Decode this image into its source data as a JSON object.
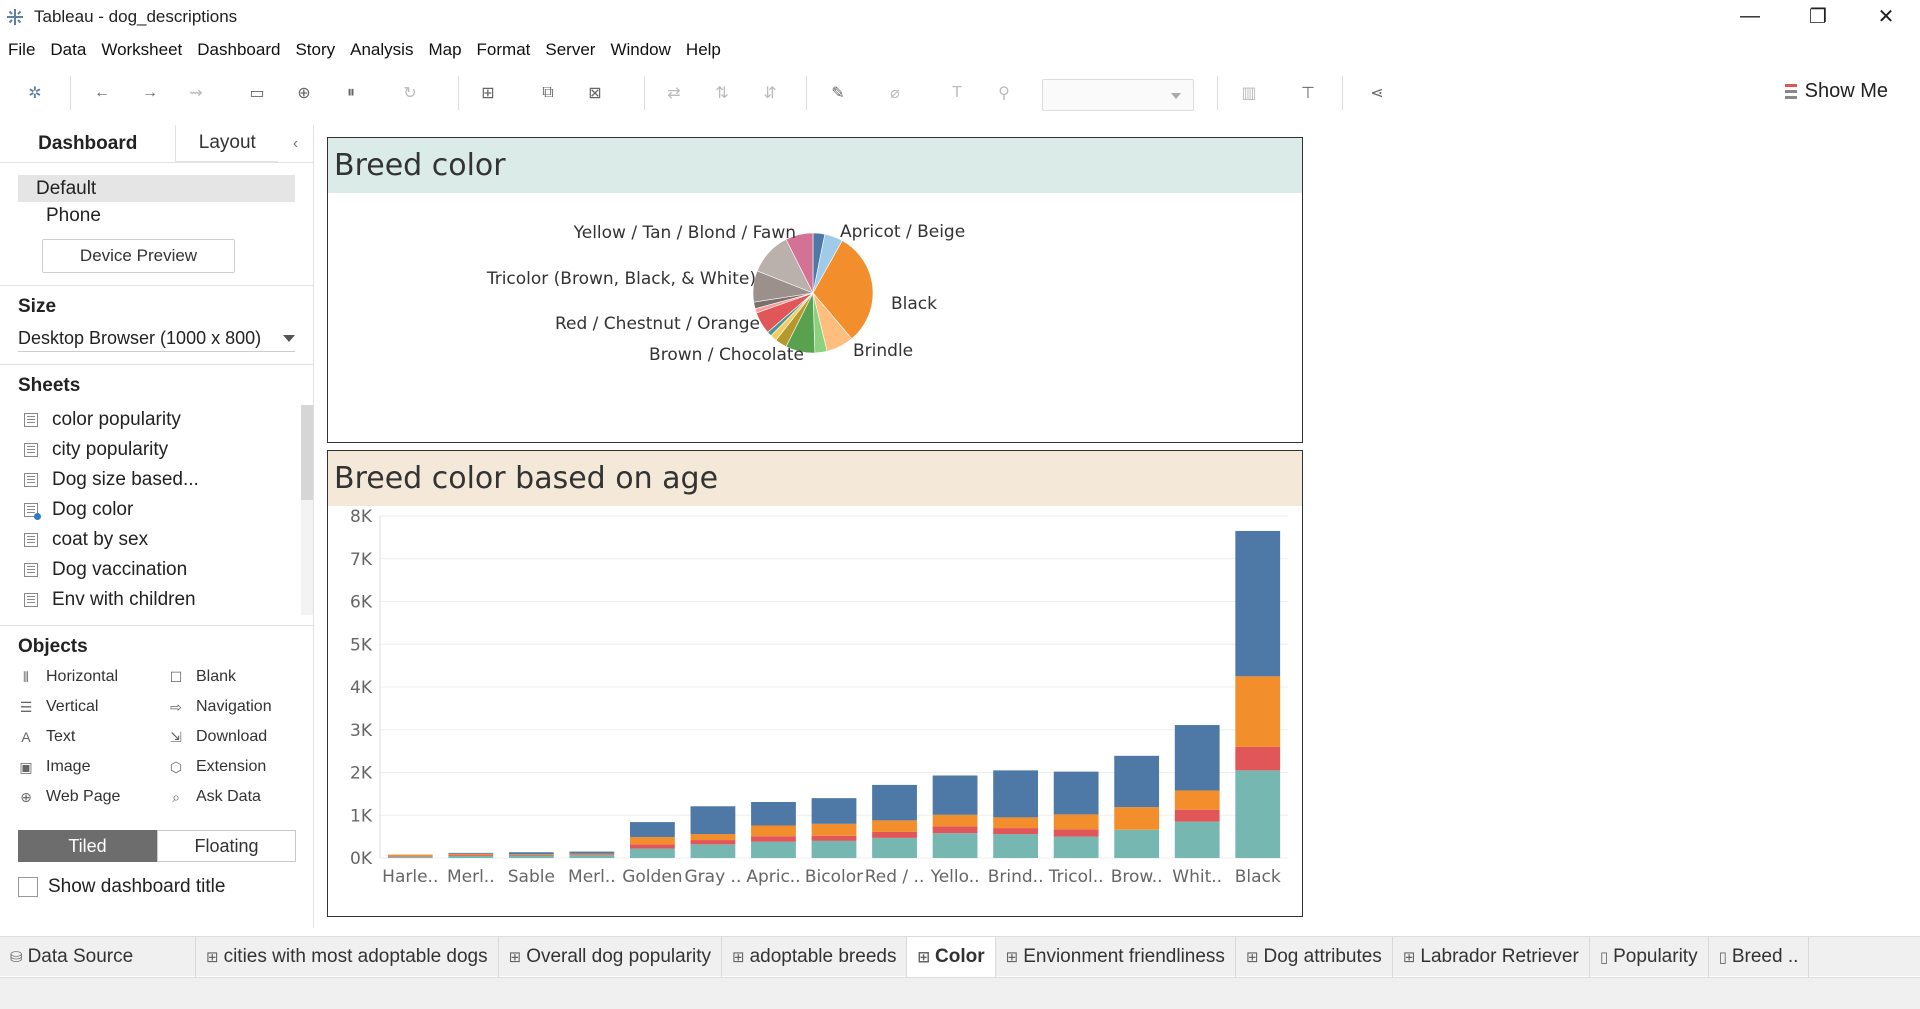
{
  "window": {
    "title": "Tableau - dog_descriptions",
    "minimize_glyph": "—",
    "restore_glyph": "❐",
    "close_glyph": "✕"
  },
  "menu": [
    "File",
    "Data",
    "Worksheet",
    "Dashboard",
    "Story",
    "Analysis",
    "Map",
    "Format",
    "Server",
    "Window",
    "Help"
  ],
  "toolbar": {
    "show_me_label": "Show Me",
    "icons": [
      "tableau-logo-icon",
      "undo-icon",
      "redo-icon",
      "replay-icon",
      "save-icon",
      "new-data-source-icon",
      "pause-updates-icon",
      "refresh-icon",
      "new-worksheet-icon",
      "duplicate-icon",
      "clear-icon",
      "swap-icon",
      "sort-ascending-icon",
      "sort-descending-icon",
      "highlight-icon",
      "group-icon",
      "labels-icon",
      "fix-axes-icon",
      "fit-dropdown",
      "show-cards-icon",
      "presentation-icon",
      "share-icon"
    ]
  },
  "left_panel": {
    "tabs": {
      "dashboard": "Dashboard",
      "layout": "Layout",
      "collapse": "‹"
    },
    "devices": {
      "default": "Default",
      "phone": "Phone",
      "preview_button": "Device Preview"
    },
    "size": {
      "title": "Size",
      "value": "Desktop Browser (1000 x 800)"
    },
    "sheets": {
      "title": "Sheets",
      "items": [
        "color popularity",
        "city popularity",
        "Dog size based...",
        "Dog color",
        "coat by sex",
        "Dog vaccination",
        "Env with children"
      ]
    },
    "objects": {
      "title": "Objects",
      "items": [
        {
          "label": "Horizontal",
          "icon": "⫴"
        },
        {
          "label": "Blank",
          "icon": "☐"
        },
        {
          "label": "Vertical",
          "icon": "☰"
        },
        {
          "label": "Navigation",
          "icon": "⇨"
        },
        {
          "label": "Text",
          "icon": "A"
        },
        {
          "label": "Download",
          "icon": "⇲"
        },
        {
          "label": "Image",
          "icon": "▣"
        },
        {
          "label": "Extension",
          "icon": "⬡"
        },
        {
          "label": "Web Page",
          "icon": "⊕"
        },
        {
          "label": "Ask Data",
          "icon": "⌕"
        }
      ]
    },
    "tiled_label": "Tiled",
    "floating_label": "Floating",
    "show_dashboard_title": "Show dashboard title"
  },
  "dashboard": {
    "pie_panel_title": "Breed color",
    "bar_panel_title": "Breed color based on age",
    "pie_title_bg": "#dbece8",
    "bar_title_bg": "#f4e8d8"
  },
  "chart_data": [
    {
      "type": "pie",
      "title": "Breed color",
      "slices": [
        {
          "label": "",
          "value": 3.2,
          "color": "#4e79a7"
        },
        {
          "label": "Apricot / Beige",
          "value": 5.0,
          "color": "#a0cbe8"
        },
        {
          "label": "Black",
          "value": 31,
          "color": "#f28e2b"
        },
        {
          "label": "Brindle",
          "value": 7.5,
          "color": "#ffbe7d"
        },
        {
          "label": "",
          "value": 3.3,
          "color": "#8cd17d"
        },
        {
          "label": "Brown / Chocolate",
          "value": 8,
          "color": "#59a14f"
        },
        {
          "label": "",
          "value": 3.2,
          "color": "#b6992d"
        },
        {
          "label": "",
          "value": 1.8,
          "color": "#f1ce63"
        },
        {
          "label": "",
          "value": 1.3,
          "color": "#499894"
        },
        {
          "label": "Red / Chestnut / Orange",
          "value": 6,
          "color": "#e15759"
        },
        {
          "label": "",
          "value": 1.2,
          "color": "#ff9d9a"
        },
        {
          "label": "",
          "value": 1.8,
          "color": "#79706e"
        },
        {
          "label": "Tricolor (Brown, Black, & White)",
          "value": 8.5,
          "color": "#9c908d"
        },
        {
          "label": "",
          "value": 11.7,
          "color": "#bab0ac"
        },
        {
          "label": "Yellow / Tan / Blond / Fawn",
          "value": 7.5,
          "color": "#d37295"
        }
      ]
    },
    {
      "type": "bar",
      "title": "Breed color based on age",
      "categories": [
        "Harle..",
        "Merl..",
        "Sable",
        "Merl..",
        "Golden",
        "Gray ..",
        "Apric..",
        "Bicolor",
        "Red / ..",
        "Yello..",
        "Brind..",
        "Tricol..",
        "Brow..",
        "Whit..",
        "Black"
      ],
      "series": [
        {
          "name": "",
          "color": "#76b7b2",
          "values": [
            30,
            50,
            60,
            70,
            220,
            320,
            380,
            400,
            470,
            580,
            560,
            500,
            660,
            850,
            2050
          ]
        },
        {
          "name": "",
          "color": "#e15759",
          "values": [
            15,
            20,
            10,
            15,
            100,
            100,
            130,
            120,
            140,
            160,
            140,
            170,
            0,
            280,
            550
          ]
        },
        {
          "name": "",
          "color": "#f28e2b",
          "values": [
            35,
            30,
            20,
            20,
            170,
            140,
            250,
            280,
            270,
            270,
            250,
            350,
            530,
            450,
            1650
          ]
        },
        {
          "name": "",
          "color": "#4e79a7",
          "values": [
            0,
            20,
            45,
            45,
            350,
            650,
            550,
            600,
            830,
            920,
            1100,
            1000,
            1200,
            1530,
            3400
          ]
        }
      ],
      "yticks": [
        "0K",
        "1K",
        "2K",
        "3K",
        "4K",
        "5K",
        "6K",
        "7K",
        "8K"
      ],
      "ylim": [
        0,
        8000
      ],
      "xlabel": "",
      "ylabel": "",
      "grid": true
    }
  ],
  "bottom_tabs": [
    {
      "label": "Data Source",
      "icon": "⛁",
      "active": false
    },
    {
      "label": "cities with most adoptable dogs",
      "icon": "⊞",
      "active": false
    },
    {
      "label": "Overall dog popularity",
      "icon": "⊞",
      "active": false
    },
    {
      "label": "adoptable breeds",
      "icon": "⊞",
      "active": false
    },
    {
      "label": "Color",
      "icon": "⊞",
      "active": true
    },
    {
      "label": "Envionment friendliness",
      "icon": "⊞",
      "active": false
    },
    {
      "label": "Dog attributes",
      "icon": "⊞",
      "active": false
    },
    {
      "label": "Labrador Retriever",
      "icon": "⊞",
      "active": false
    },
    {
      "label": "Popularity",
      "icon": "▯",
      "active": false
    },
    {
      "label": "Breed ..",
      "icon": "▯",
      "active": false
    }
  ]
}
